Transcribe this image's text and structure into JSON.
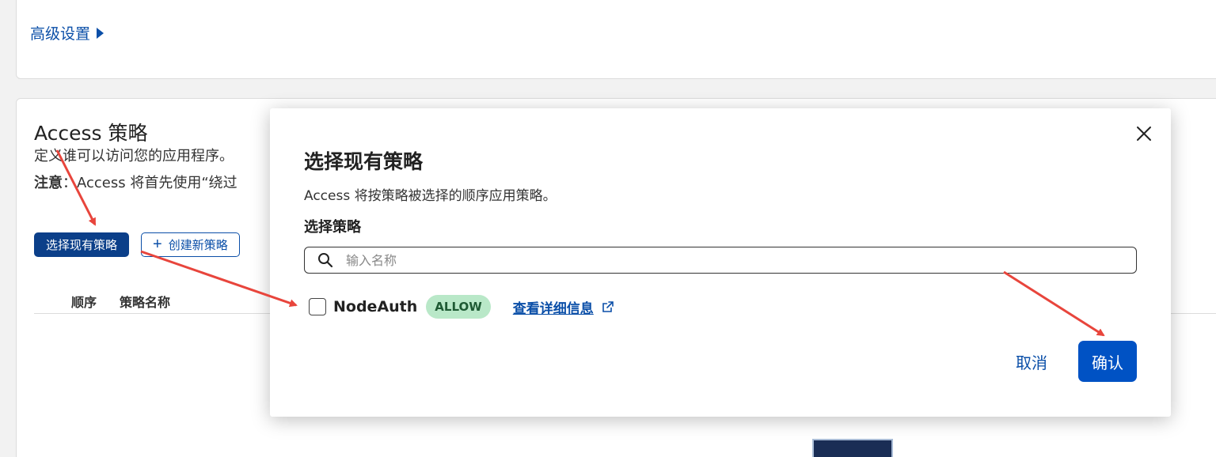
{
  "background": {
    "advanced_settings": "高级设置",
    "section_title": "Access 策略",
    "section_desc": "定义谁可以访问您的应用程序。",
    "note_label": "注意",
    "note_text": "：Access 将首先使用“绕过",
    "btn_select_existing": "选择现有策略",
    "btn_create_new": "创建新策略",
    "col_order": "顺序",
    "col_policy_name": "策略名称"
  },
  "dialog": {
    "title": "选择现有策略",
    "subtitle": "Access 将按策略被选择的顺序应用策略。",
    "select_label": "选择策略",
    "search_placeholder": "输入名称",
    "policy": {
      "name": "NodeAuth",
      "badge": "ALLOW",
      "detail_link": "查看详细信息",
      "checked": false
    },
    "cancel_label": "取消",
    "confirm_label": "确认"
  },
  "icons": {
    "close": "close-icon",
    "search": "search-icon",
    "external": "external-link-icon",
    "advanced_toggle": "caret-right-icon",
    "plus": "plus-icon"
  },
  "colors": {
    "primary": "#0052c4",
    "link": "#0b4fa8",
    "badge_bg": "#b9e8c8",
    "annotation_arrow": "#e8453c"
  }
}
